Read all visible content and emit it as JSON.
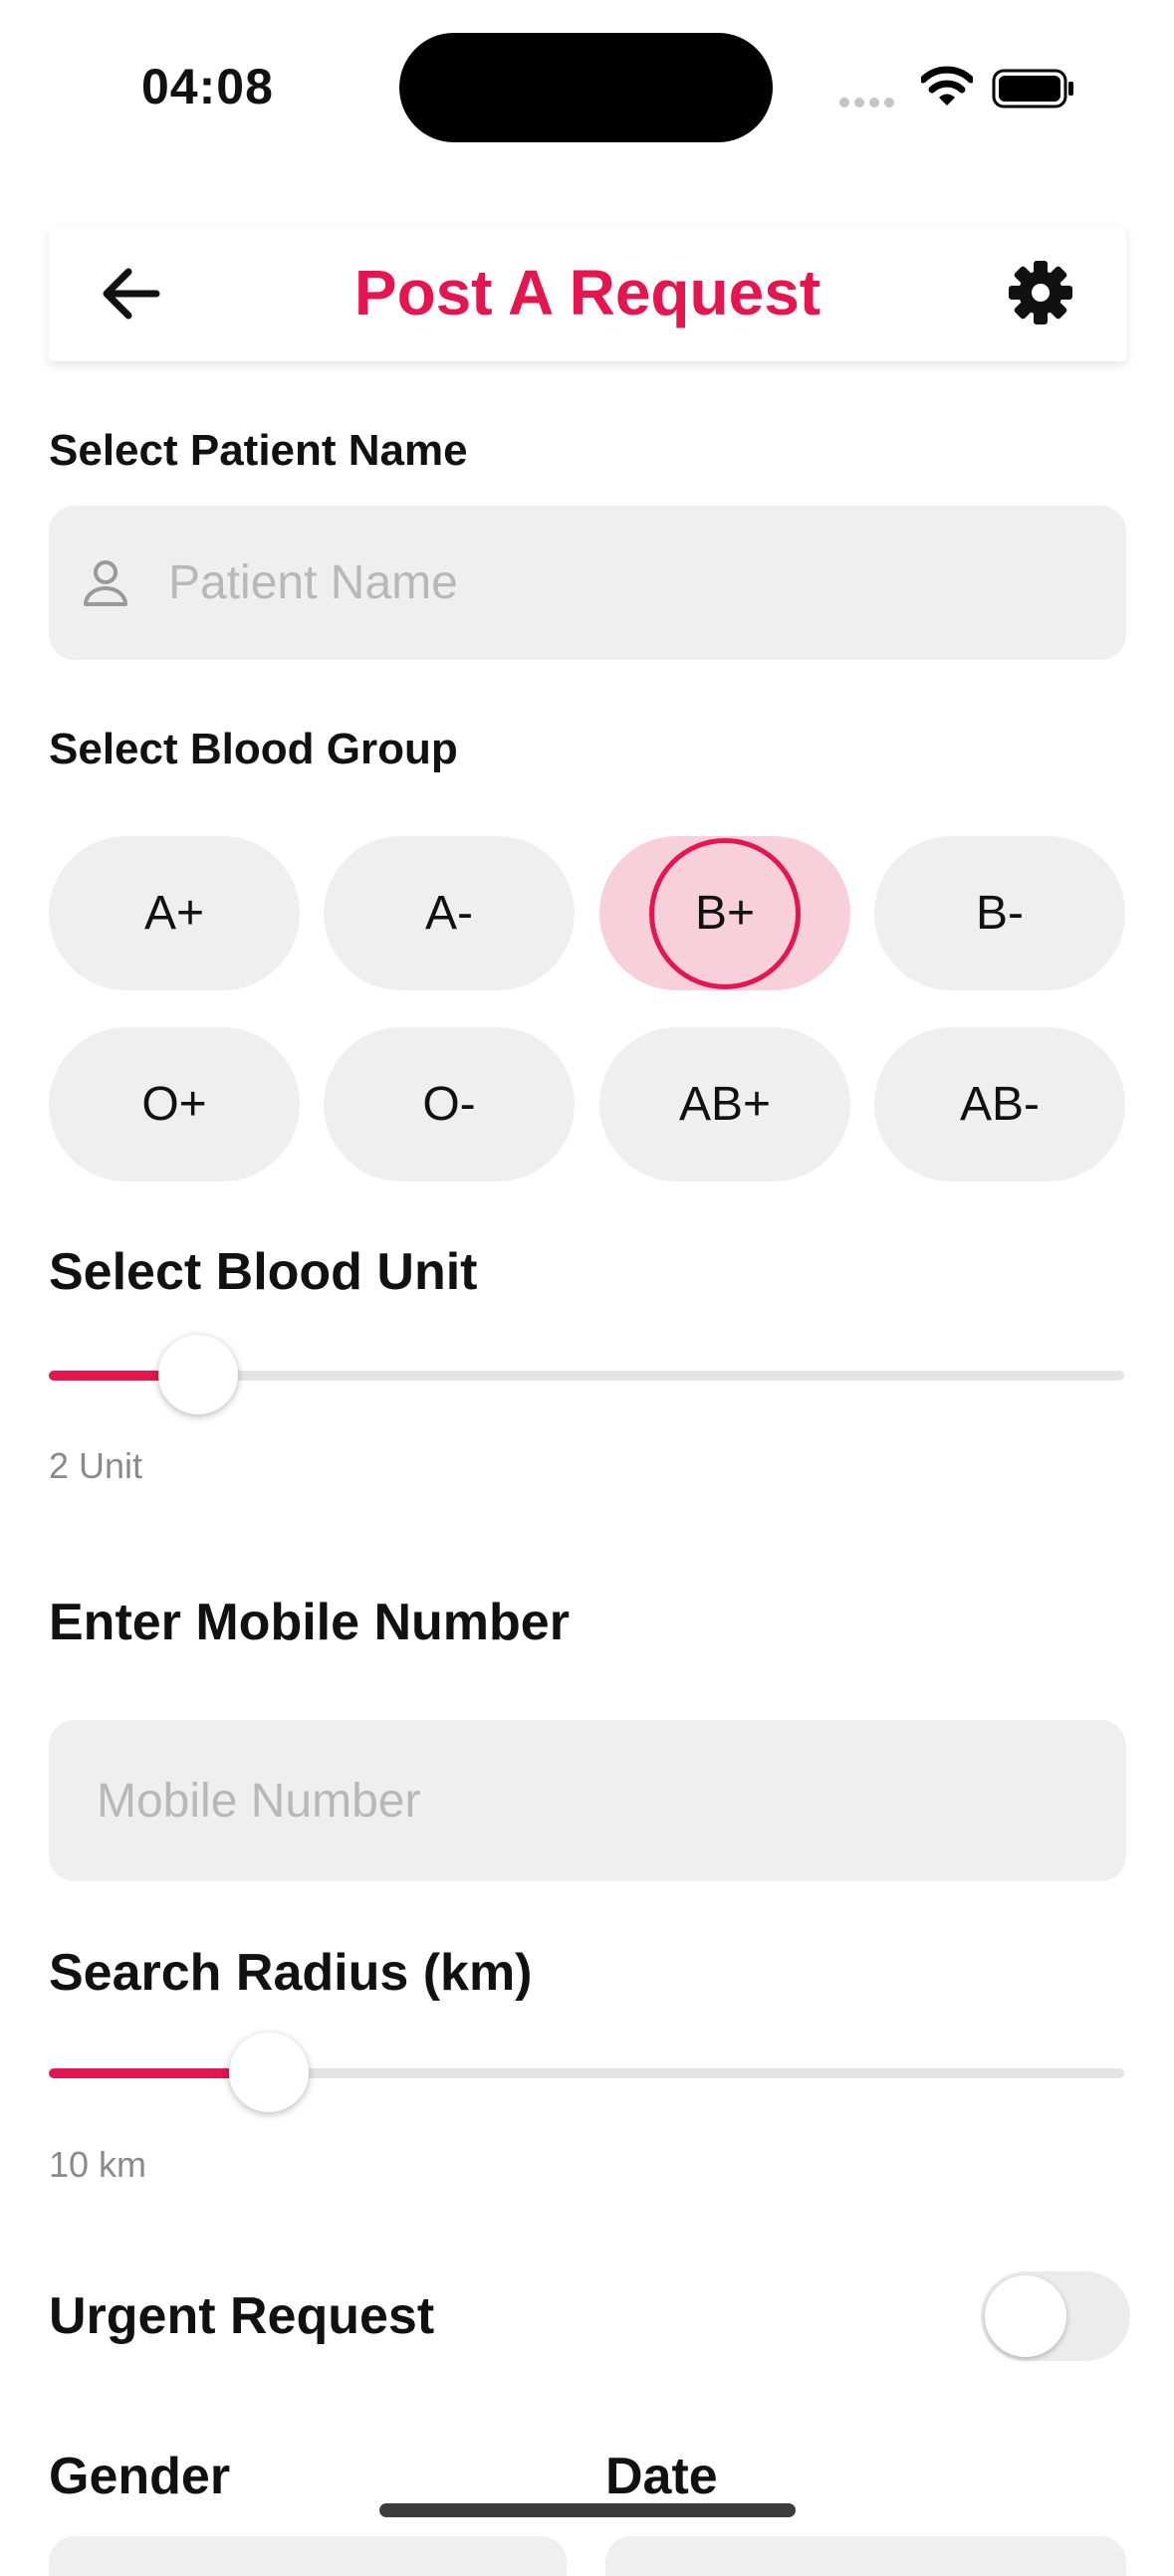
{
  "status_bar": {
    "time": "04:08"
  },
  "header": {
    "title": "Post A Request"
  },
  "patient": {
    "label": "Select Patient Name",
    "placeholder": "Patient Name"
  },
  "blood_group": {
    "label": "Select Blood Group",
    "options": [
      "A+",
      "A-",
      "B+",
      "B-",
      "O+",
      "O-",
      "AB+",
      "AB-"
    ],
    "selected": "B+"
  },
  "blood_unit": {
    "label": "Select Blood Unit",
    "value_text": "2 Unit",
    "value": 2
  },
  "mobile": {
    "label": "Enter Mobile Number",
    "placeholder": "Mobile Number"
  },
  "radius": {
    "label": "Search Radius (km)",
    "value_text": "10 km",
    "value": 10
  },
  "urgent": {
    "label": "Urgent Request",
    "on": false
  },
  "gender": {
    "label": "Gender"
  },
  "date": {
    "label": "Date"
  },
  "colors": {
    "accent": "#e5154f",
    "selected_bg": "#f8d0dc",
    "field_bg": "#efefef"
  }
}
